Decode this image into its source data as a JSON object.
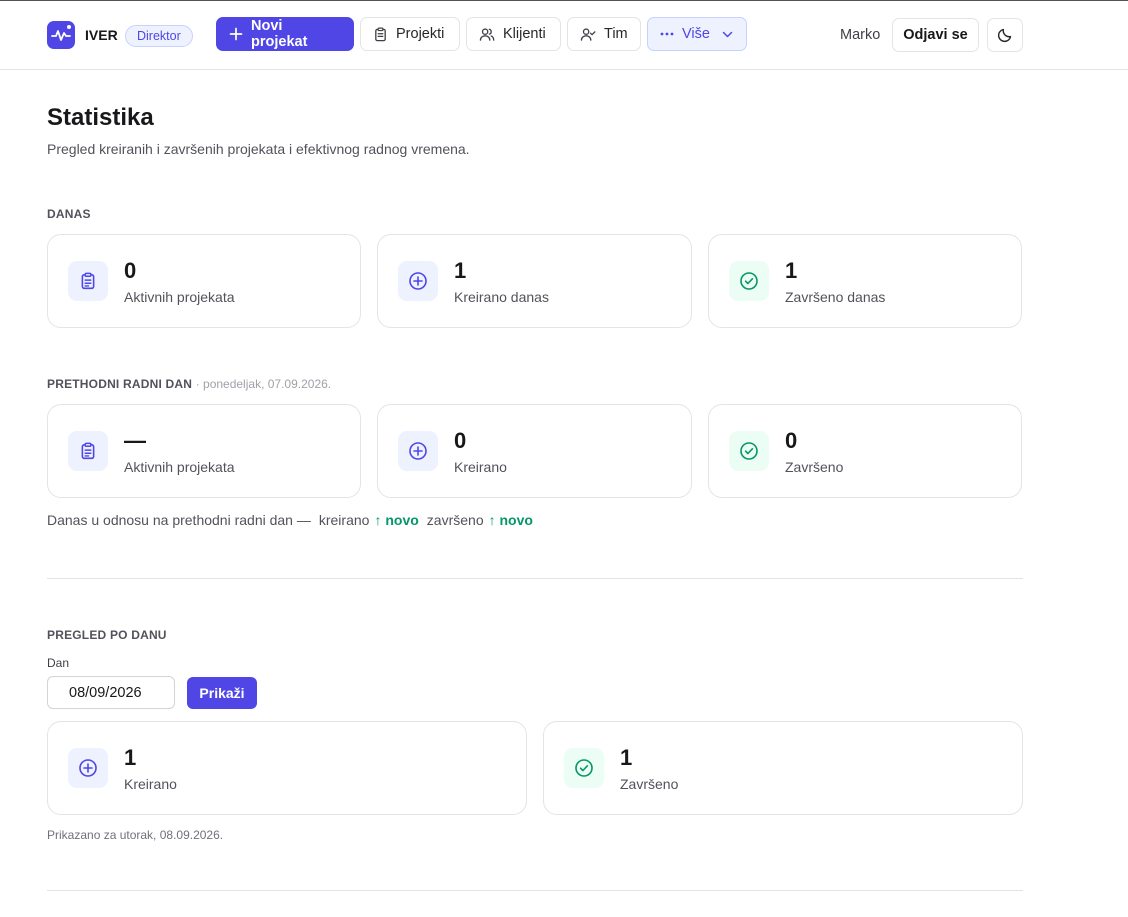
{
  "header": {
    "brand": "IVER",
    "role": "Direktor",
    "nav": {
      "new_project": "Novi projekat",
      "projects": "Projekti",
      "clients": "Klijenti",
      "team": "Tim",
      "more": "Više"
    },
    "user": "Marko",
    "logout": "Odjavi se"
  },
  "page": {
    "title": "Statistika",
    "subtitle": "Pregled kreiranih i završenih projekata i efektivnog radnog vremena."
  },
  "today": {
    "label": "DANAS",
    "cards": [
      {
        "value": "0",
        "label": "Aktivnih projekata"
      },
      {
        "value": "1",
        "label": "Kreirano danas"
      },
      {
        "value": "1",
        "label": "Završeno danas"
      }
    ]
  },
  "previous": {
    "label": "PRETHODNI RADNI DAN",
    "date": "· ponedeljak, 07.09.2026.",
    "cards": [
      {
        "value": "—",
        "label": "Aktivnih projekata"
      },
      {
        "value": "0",
        "label": "Kreirano"
      },
      {
        "value": "0",
        "label": "Završeno"
      }
    ]
  },
  "comparison": {
    "prefix": "Danas u odnosu na prethodni radni dan —",
    "created_label": "kreirano",
    "created_value": "↑ novo",
    "completed_label": "završeno",
    "completed_value": "↑ novo"
  },
  "by_day": {
    "label": "PREGLED PO DANU",
    "field_label": "Dan",
    "date_value": "08/09/2026",
    "show_button": "Prikaži",
    "cards": [
      {
        "value": "1",
        "label": "Kreirano"
      },
      {
        "value": "1",
        "label": "Završeno"
      }
    ],
    "shown_for": "Prikazano za utorak, 08.09.2026."
  },
  "colors": {
    "accent": "#4f46e5",
    "success": "#059669",
    "border": "#e4e4e7"
  }
}
